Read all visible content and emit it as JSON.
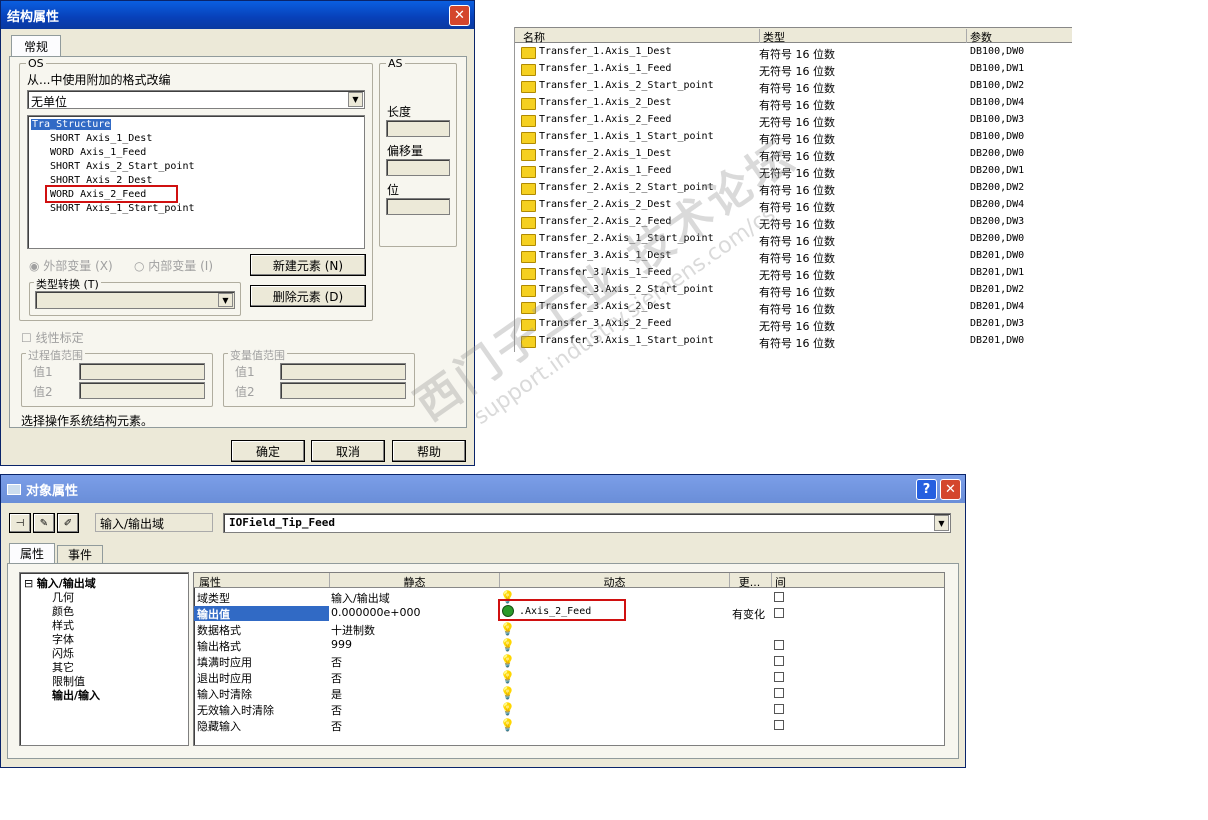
{
  "struct_dialog": {
    "title": "结构属性",
    "tab": "常规",
    "os_group": "OS",
    "os_desc": "从...中使用附加的格式改编",
    "unit_select": "无单位",
    "tree_root": "Tra_Structure",
    "tree_items": [
      "SHORT Axis_1_Dest",
      "WORD Axis_1_Feed",
      "SHORT Axis_2_Start_point",
      "SHORT Axis_2_Dest",
      "WORD Axis_2_Feed",
      "SHORT Axis_1_Start_point"
    ],
    "as_group": "AS",
    "length_label": "长度",
    "offset_label": "偏移量",
    "bit_label": "位",
    "ext_var": "外部变量 (X)",
    "int_var": "内部变量 (I)",
    "new_elem": "新建元素 (N)",
    "del_elem": "删除元素 (D)",
    "type_conv": "类型转换 (T)",
    "linear_scale": "线性标定",
    "proc_range": "过程值范围",
    "var_range": "变量值范围",
    "val1": "值1",
    "val2": "值2",
    "status": "选择操作系统结构元素。",
    "ok": "确定",
    "cancel": "取消",
    "help": "帮助"
  },
  "tag_list": {
    "headers": [
      "名称",
      "类型",
      "参数"
    ],
    "rows": [
      [
        "Transfer_1.Axis_1_Dest",
        "有符号 16 位数",
        "DB100,DW0"
      ],
      [
        "Transfer_1.Axis_1_Feed",
        "无符号 16 位数",
        "DB100,DW1"
      ],
      [
        "Transfer_1.Axis_2_Start_point",
        "有符号 16 位数",
        "DB100,DW2"
      ],
      [
        "Transfer_1.Axis_2_Dest",
        "有符号 16 位数",
        "DB100,DW4"
      ],
      [
        "Transfer_1.Axis_2_Feed",
        "无符号 16 位数",
        "DB100,DW3"
      ],
      [
        "Transfer_1.Axis_1_Start_point",
        "有符号 16 位数",
        "DB100,DW0"
      ],
      [
        "Transfer_2.Axis_1_Dest",
        "有符号 16 位数",
        "DB200,DW0"
      ],
      [
        "Transfer_2.Axis_1_Feed",
        "无符号 16 位数",
        "DB200,DW1"
      ],
      [
        "Transfer_2.Axis_2_Start_point",
        "有符号 16 位数",
        "DB200,DW2"
      ],
      [
        "Transfer_2.Axis_2_Dest",
        "有符号 16 位数",
        "DB200,DW4"
      ],
      [
        "Transfer_2.Axis_2_Feed",
        "无符号 16 位数",
        "DB200,DW3"
      ],
      [
        "Transfer_2.Axis_1_Start_point",
        "有符号 16 位数",
        "DB200,DW0"
      ],
      [
        "Transfer_3.Axis_1_Dest",
        "有符号 16 位数",
        "DB201,DW0"
      ],
      [
        "Transfer_3.Axis_1_Feed",
        "无符号 16 位数",
        "DB201,DW1"
      ],
      [
        "Transfer_3.Axis_2_Start_point",
        "有符号 16 位数",
        "DB201,DW2"
      ],
      [
        "Transfer_3.Axis_2_Dest",
        "有符号 16 位数",
        "DB201,DW4"
      ],
      [
        "Transfer_3.Axis_2_Feed",
        "无符号 16 位数",
        "DB201,DW3"
      ],
      [
        "Transfer_3.Axis_1_Start_point",
        "有符号 16 位数",
        "DB201,DW0"
      ]
    ]
  },
  "obj_dialog": {
    "title": "对象属性",
    "help_btn": "?",
    "close_btn": "X",
    "type_label": "输入/输出域",
    "obj_name": "IOField_Tip_Feed",
    "tab_props": "属性",
    "tab_events": "事件",
    "tree_root": "输入/输出域",
    "tree_items": [
      "几何",
      "颜色",
      "样式",
      "字体",
      "闪烁",
      "其它",
      "限制值",
      "输出/输入"
    ],
    "col_headers": [
      "属性",
      "静态",
      "动态",
      "更...",
      "间"
    ],
    "rows": [
      [
        "域类型",
        "输入/输出域",
        "",
        ""
      ],
      [
        "输出值",
        "0.000000e+000",
        ".Axis_2_Feed",
        "有变化"
      ],
      [
        "数据格式",
        "十进制数",
        "",
        ""
      ],
      [
        "输出格式",
        "999",
        "",
        ""
      ],
      [
        "填满时应用",
        "否",
        "",
        ""
      ],
      [
        "退出时应用",
        "否",
        "",
        ""
      ],
      [
        "输入时清除",
        "是",
        "",
        ""
      ],
      [
        "无效输入时清除",
        "否",
        "",
        ""
      ],
      [
        "隐藏输入",
        "否",
        "",
        ""
      ]
    ]
  },
  "watermark": {
    "cn": "西门子工业 技术论坛",
    "en": "support.industry.siemens.com/cs"
  }
}
